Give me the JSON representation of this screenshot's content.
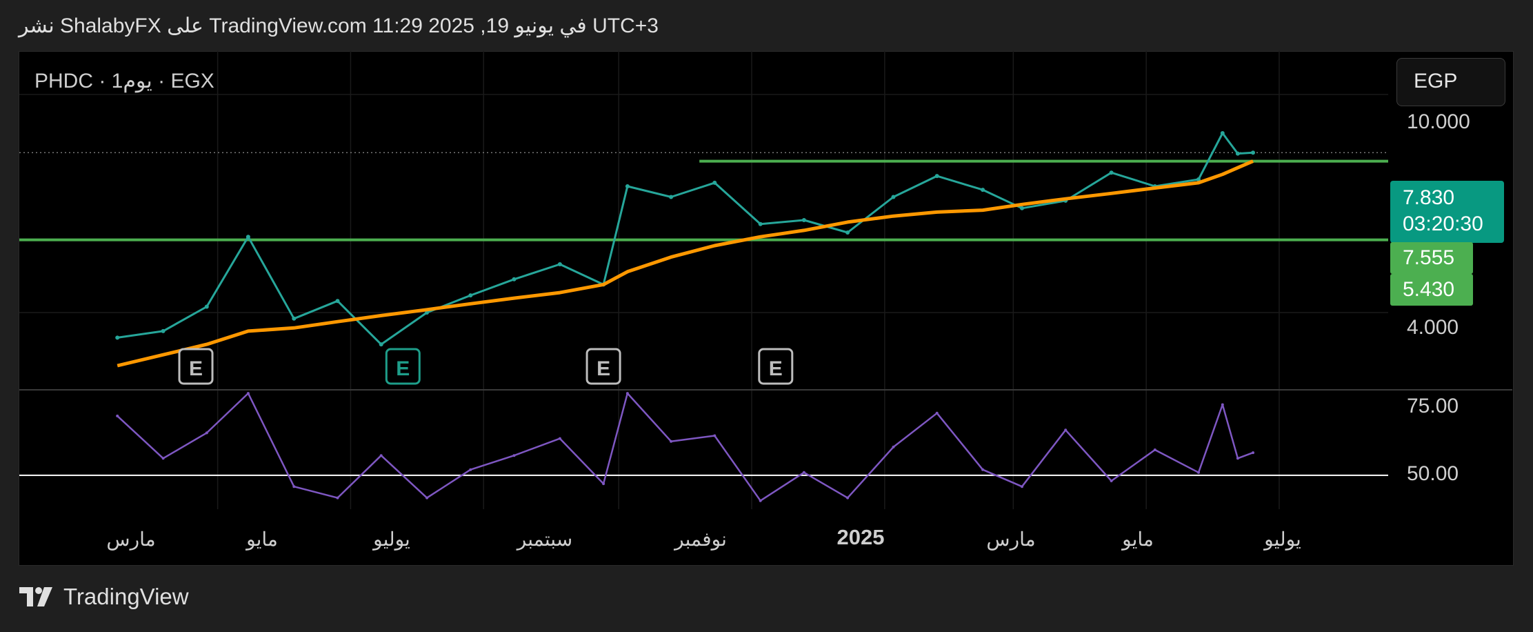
{
  "header": {
    "publish_line": "نشر ShalabyFX على TradingView.com 11:29 2025 ,19 في يونيو UTC+3"
  },
  "symbol": {
    "label": "PHDC · 1يوم · EGX"
  },
  "currency": {
    "label": "EGP"
  },
  "price_axis": {
    "labels": [
      "10.000",
      "4.000"
    ]
  },
  "price_tags": [
    {
      "value": "7.830",
      "sub": "03:20:30",
      "color": "#089981"
    },
    {
      "value": "7.555",
      "color": "#4caf50"
    },
    {
      "value": "5.430",
      "color": "#4caf50"
    }
  ],
  "rsi_axis": {
    "labels": [
      "75.00",
      "50.00"
    ]
  },
  "time_axis": {
    "labels": [
      "مارس",
      "مايو",
      "يوليو",
      "سبتمبر",
      "نوفمبر",
      "2025",
      "مارس",
      "مايو",
      "يوليو"
    ]
  },
  "earnings_markers": [
    "E",
    "E",
    "E",
    "E"
  ],
  "brand": {
    "name": "TradingView"
  },
  "chart_data": [
    {
      "type": "line",
      "title": "PHDC · 1يوم · EGX",
      "scale": "log",
      "ylim": [
        2.9,
        12
      ],
      "yticks": [
        10,
        4
      ],
      "x": [
        "2024-01-15",
        "2024-02-05",
        "2024-02-25",
        "2024-03-15",
        "2024-04-05",
        "2024-04-25",
        "2024-05-15",
        "2024-06-05",
        "2024-06-25",
        "2024-07-15",
        "2024-08-05",
        "2024-08-25",
        "2024-09-05",
        "2024-09-25",
        "2024-10-15",
        "2024-11-05",
        "2024-11-25",
        "2024-12-15",
        "2025-01-05",
        "2025-01-25",
        "2025-02-15",
        "2025-03-05",
        "2025-03-25",
        "2025-04-15",
        "2025-05-05",
        "2025-05-25",
        "2025-06-05",
        "2025-06-12",
        "2025-06-19"
      ],
      "series": [
        {
          "values": [
            3.6,
            3.7,
            4.1,
            5.5,
            3.9,
            4.2,
            3.5,
            4.0,
            4.3,
            4.6,
            4.9,
            4.5,
            6.8,
            6.5,
            6.9,
            5.8,
            5.9,
            5.6,
            6.5,
            7.1,
            6.7,
            6.2,
            6.4,
            7.2,
            6.8,
            7.0,
            8.5,
            7.8,
            7.83
          ],
          "color": "#26a69a"
        },
        {
          "values": [
            3.2,
            3.35,
            3.5,
            3.7,
            3.75,
            3.85,
            3.95,
            4.05,
            4.15,
            4.25,
            4.35,
            4.5,
            4.75,
            5.05,
            5.3,
            5.5,
            5.65,
            5.85,
            6.0,
            6.1,
            6.15,
            6.3,
            6.45,
            6.6,
            6.75,
            6.9,
            7.15,
            7.35,
            7.555
          ],
          "color": "#ff9800"
        }
      ],
      "levels": [
        {
          "value": 7.555,
          "color": "#4caf50"
        },
        {
          "value": 5.43,
          "color": "#4caf50"
        }
      ],
      "current": 7.83
    },
    {
      "type": "line",
      "ylim": [
        38,
        80
      ],
      "yticks": [
        75,
        50
      ],
      "reference": 50,
      "x": [
        "2024-01-15",
        "2024-02-05",
        "2024-02-25",
        "2024-03-15",
        "2024-04-05",
        "2024-04-25",
        "2024-05-15",
        "2024-06-05",
        "2024-06-25",
        "2024-07-15",
        "2024-08-05",
        "2024-08-25",
        "2024-09-05",
        "2024-09-25",
        "2024-10-15",
        "2024-11-05",
        "2024-11-25",
        "2024-12-15",
        "2025-01-05",
        "2025-01-25",
        "2025-02-15",
        "2025-03-05",
        "2025-03-25",
        "2025-04-15",
        "2025-05-05",
        "2025-05-25",
        "2025-06-05",
        "2025-06-12",
        "2025-06-19"
      ],
      "series": [
        {
          "values": [
            71,
            56,
            65,
            79,
            46,
            42,
            57,
            42,
            52,
            57,
            63,
            47,
            79,
            62,
            64,
            41,
            51,
            42,
            60,
            72,
            52,
            46,
            66,
            48,
            59,
            51,
            75,
            56,
            58
          ],
          "color": "#7e57c2"
        }
      ]
    }
  ]
}
